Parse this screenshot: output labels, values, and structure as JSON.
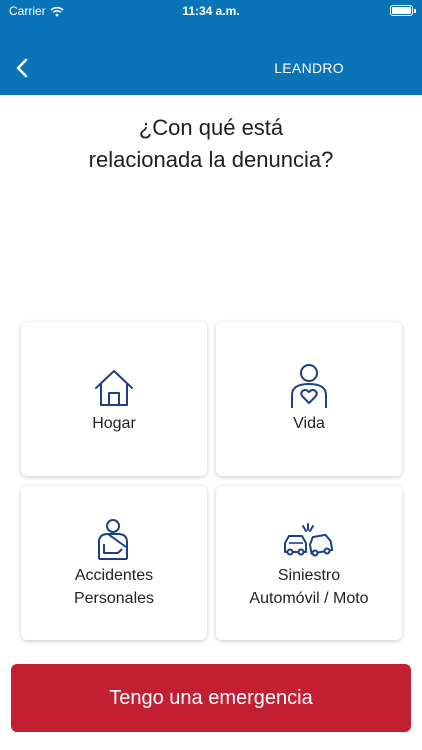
{
  "status_bar": {
    "carrier": "Carrier",
    "time": "11:34 a.m."
  },
  "nav": {
    "back_icon": "chevron-left-icon",
    "user_name": "LEANDRO"
  },
  "question": {
    "line1": "¿Con qué está",
    "line2": "relacionada la denuncia?"
  },
  "options": [
    {
      "icon": "house-icon",
      "label": "Hogar"
    },
    {
      "icon": "person-heart-icon",
      "label": "Vida"
    },
    {
      "icon": "injured-person-icon",
      "label_line1": "Accidentes",
      "label_line2": "Personales"
    },
    {
      "icon": "car-crash-icon",
      "label_line1": "Siniestro",
      "label_line2": "Automóvil / Moto"
    }
  ],
  "emergency": {
    "label": "Tengo una emergencia"
  },
  "colors": {
    "header": "#0a74b8",
    "icon": "#1c3f86",
    "emergency": "#c21f32"
  }
}
